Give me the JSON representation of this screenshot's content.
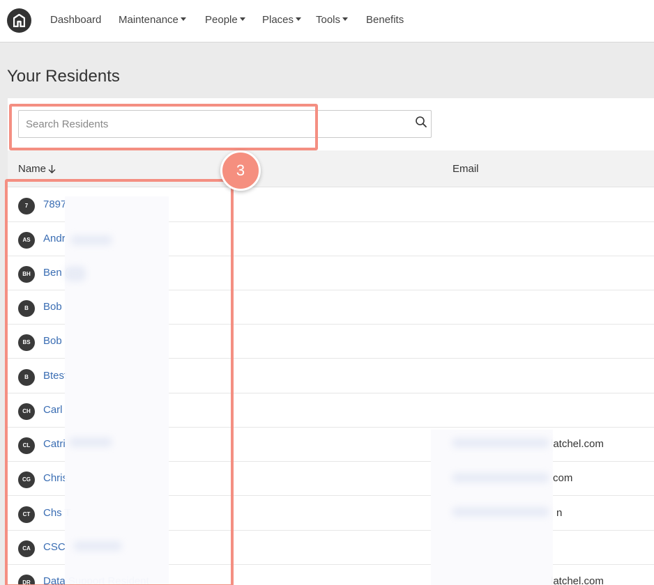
{
  "nav": {
    "logo_icon": "home-icon",
    "items": [
      {
        "label": "Dashboard",
        "dropdown": false
      },
      {
        "label": "Maintenance",
        "dropdown": true
      },
      {
        "label": "People",
        "dropdown": true
      },
      {
        "label": "Places",
        "dropdown": true
      },
      {
        "label": "Tools",
        "dropdown": true
      },
      {
        "label": "Benefits",
        "dropdown": false
      }
    ]
  },
  "page": {
    "title": "Your Residents"
  },
  "search": {
    "placeholder": "Search Residents",
    "value": "",
    "icon": "search-icon"
  },
  "table": {
    "columns": [
      {
        "label": "Name",
        "sort": "descending"
      },
      {
        "label": "Email"
      }
    ],
    "rows": [
      {
        "initials": "7",
        "name": "7897",
        "email": ""
      },
      {
        "initials": "AS",
        "name": "Andr",
        "email": ""
      },
      {
        "initials": "BH",
        "name": "Ben (",
        "email": ""
      },
      {
        "initials": "B",
        "name": "Bob",
        "email": ""
      },
      {
        "initials": "BS",
        "name": "Bob",
        "email": ""
      },
      {
        "initials": "B",
        "name": "Btest",
        "email": ""
      },
      {
        "initials": "CH",
        "name": "Carl",
        "email": ""
      },
      {
        "initials": "CL",
        "name": "Catri",
        "email": "latchel.com"
      },
      {
        "initials": "CG",
        "name": "Chris",
        "email": "com"
      },
      {
        "initials": "CT",
        "name": "Chs T",
        "email": "n"
      },
      {
        "initials": "CA",
        "name": "CSC",
        "email": ""
      },
      {
        "initials": "DR",
        "name": "Data Support Resident",
        "email": "latchel.com"
      }
    ]
  },
  "annotation": {
    "step_number": "3",
    "highlight_color": "#f48f82"
  },
  "colors": {
    "link": "#3a6db3",
    "avatar": "#3a3a3a",
    "page_bg": "#ebebeb",
    "header_bg": "#f2f2f2"
  }
}
